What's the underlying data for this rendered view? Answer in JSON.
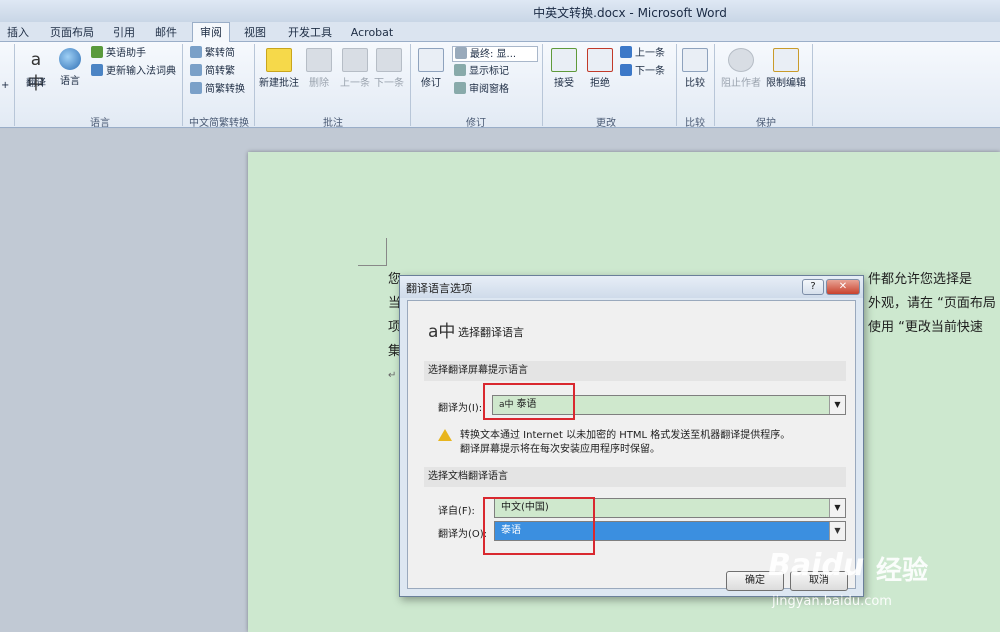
{
  "window": {
    "title": "中英文转换.docx - Microsoft Word"
  },
  "tabs": [
    "插入",
    "页面布局",
    "引用",
    "邮件",
    "审阅",
    "视图",
    "开发工具",
    "Acrobat"
  ],
  "active_tab": "审阅",
  "ribbon": {
    "groups": {
      "lang": "语言",
      "convert": "中文简繁转换",
      "comment": "批注",
      "track": "修订",
      "changes": "更改",
      "compare": "比较",
      "protect": "保护"
    },
    "translate": "翻译",
    "language": "语言",
    "english_assistant": "英语助手",
    "update_ime": "更新输入法词典",
    "to_simplified": "繁转简",
    "to_traditional": "简转繁",
    "convert_sc_tc": "简繁转换",
    "new_comment": "新建批注",
    "delete": "删除",
    "prev": "上一条",
    "next": "下一条",
    "track_changes": "修订",
    "final_show": "最终: 显...",
    "show_markup": "显示标记",
    "review_pane": "审阅窗格",
    "accept": "接受",
    "reject": "拒绝",
    "prev_change": "上一条",
    "next_change": "下一条",
    "compare": "比较",
    "block_authors": "阻止作者",
    "restrict_edit": "限制编辑",
    "plus": "+"
  },
  "document": {
    "lines": [
      "您",
      "当",
      "项",
      "集"
    ],
    "right_fragments": [
      "件都允许您选择是",
      "外观，请在 “页面布局",
      "使用 “更改当前快速"
    ],
    "para_mark": "↵"
  },
  "dialog": {
    "title": "翻译语言选项",
    "help": "?",
    "close": "✕",
    "header": "选择翻译语言",
    "section1": "选择翻译屏幕提示语言",
    "translate_to_label": "翻译为(I):",
    "translate_to_value": "泰语",
    "warning_line1": "转换文本通过 Internet 以未加密的 HTML 格式发送至机器翻译提供程序。",
    "warning_line2": "翻译屏幕提示将在每次安装应用程序时保留。",
    "section2": "选择文档翻译语言",
    "from_label": "译自(F):",
    "from_value": "中文(中国)",
    "doc_to_label": "翻译为(O):",
    "doc_to_value": "泰语",
    "ok": "确定",
    "cancel": "取消"
  },
  "watermark": {
    "brand": "Baidu",
    "suffix": "经验",
    "url": "jingyan.baidu.com"
  }
}
